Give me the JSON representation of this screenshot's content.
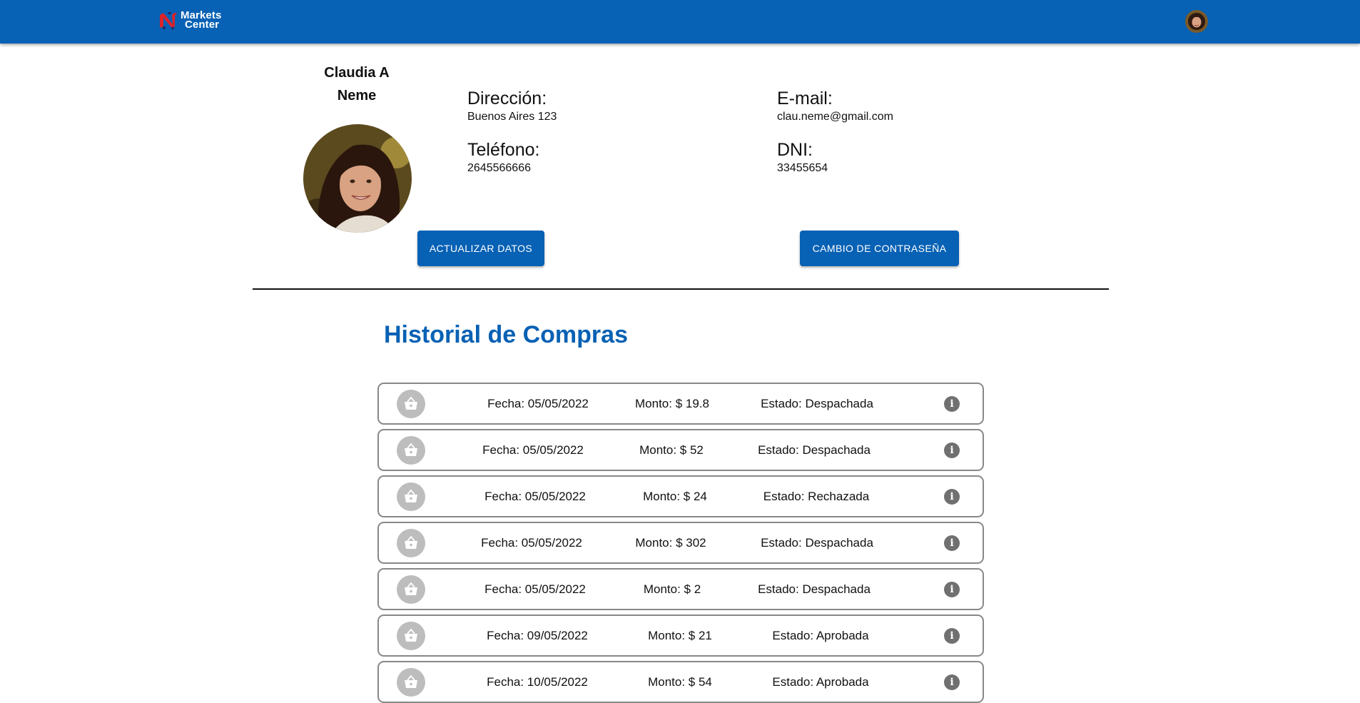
{
  "header": {
    "brand_line1": "Markets",
    "brand_line2": "Center",
    "logo_icon": "markets-center-logo-icon",
    "avatar_icon": "user-avatar-icon"
  },
  "profile": {
    "name_line1": "Claudia A",
    "name_line2": "Neme",
    "photo_icon": "profile-photo",
    "fields": {
      "address_label": "Dirección:",
      "address_value": "Buenos Aires 123",
      "email_label": "E-mail:",
      "email_value": "clau.neme@gmail.com",
      "phone_label": "Teléfono:",
      "phone_value": "2645566666",
      "dni_label": "DNI:",
      "dni_value": "33455654"
    },
    "update_button": "ACTUALIZAR DATOS",
    "password_button": "CAMBIO DE CONTRASEÑA"
  },
  "history": {
    "title": "Historial de Compras",
    "row_icon": "basket-icon",
    "info_icon": "info-icon",
    "rows": [
      {
        "fecha": "Fecha: 05/05/2022",
        "monto": "Monto: $ 19.8",
        "estado": "Estado: Despachada"
      },
      {
        "fecha": "Fecha: 05/05/2022",
        "monto": "Monto: $ 52",
        "estado": "Estado: Despachada"
      },
      {
        "fecha": "Fecha: 05/05/2022",
        "monto": "Monto: $ 24",
        "estado": "Estado: Rechazada"
      },
      {
        "fecha": "Fecha: 05/05/2022",
        "monto": "Monto: $ 302",
        "estado": "Estado: Despachada"
      },
      {
        "fecha": "Fecha: 05/05/2022",
        "monto": "Monto: $ 2",
        "estado": "Estado: Despachada"
      },
      {
        "fecha": "Fecha: 09/05/2022",
        "monto": "Monto: $ 21",
        "estado": "Estado: Aprobada"
      },
      {
        "fecha": "Fecha: 10/05/2022",
        "monto": "Monto: $ 54",
        "estado": "Estado: Aprobada"
      }
    ]
  },
  "colors": {
    "primary": "#0761b4",
    "row_border": "#888888",
    "icon_grey": "#bdbdbd"
  }
}
